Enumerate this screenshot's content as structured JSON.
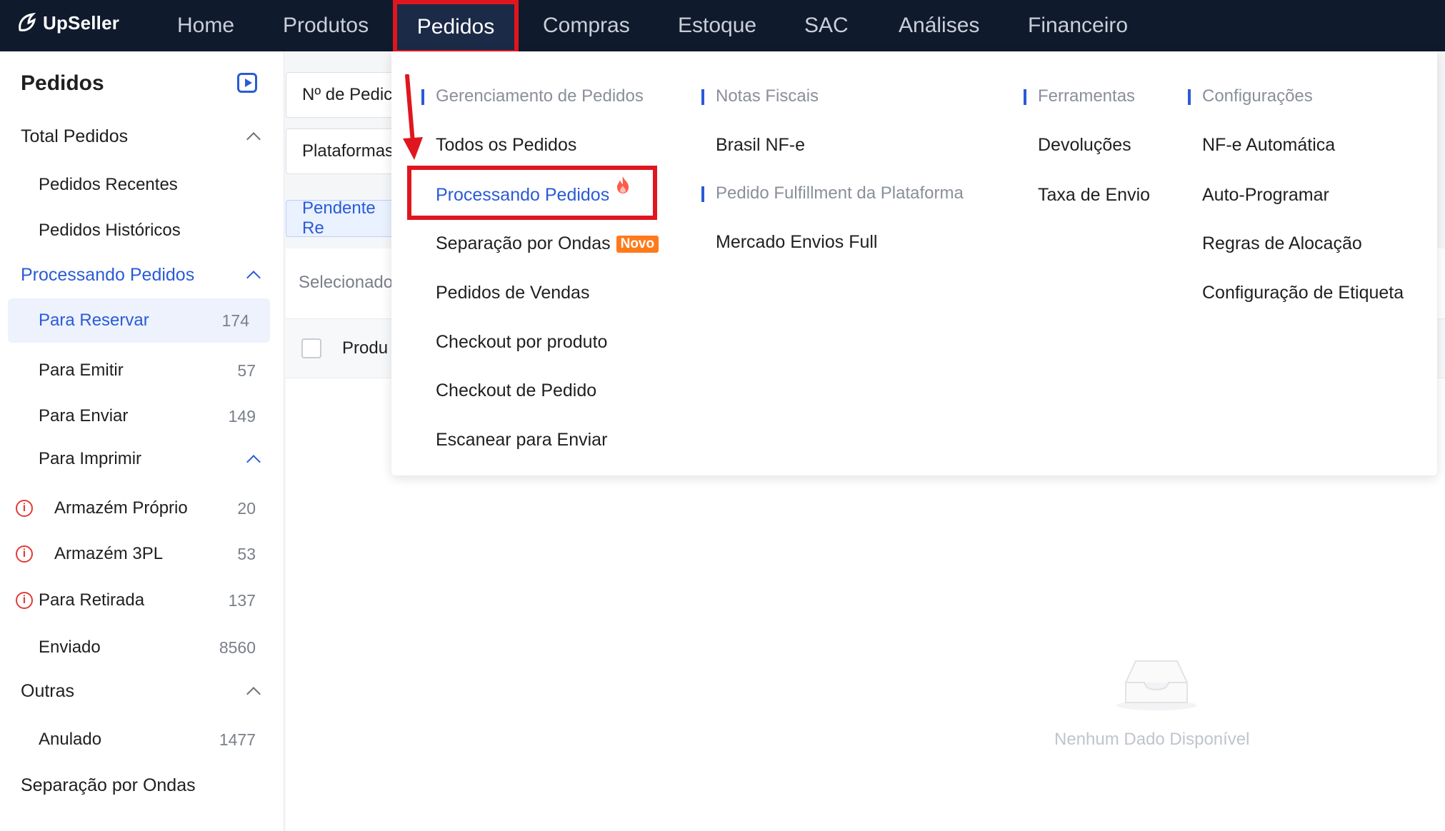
{
  "brand": {
    "name": "UpSeller"
  },
  "nav": [
    {
      "label": "Home"
    },
    {
      "label": "Produtos"
    },
    {
      "label": "Pedidos",
      "active": true
    },
    {
      "label": "Compras"
    },
    {
      "label": "Estoque"
    },
    {
      "label": "SAC"
    },
    {
      "label": "Análises"
    },
    {
      "label": "Financeiro"
    }
  ],
  "sidebar": {
    "title": "Pedidos",
    "total": {
      "label": "Total Pedidos"
    },
    "recentes": {
      "label": "Pedidos Recentes"
    },
    "historicos": {
      "label": "Pedidos Históricos"
    },
    "processando": {
      "label": "Processando Pedidos"
    },
    "para_reservar": {
      "label": "Para Reservar",
      "count": "174"
    },
    "para_emitir": {
      "label": "Para Emitir",
      "count": "57"
    },
    "para_enviar": {
      "label": "Para Enviar",
      "count": "149"
    },
    "para_imprimir": {
      "label": "Para Imprimir"
    },
    "armazem_proprio": {
      "label": "Armazém Próprio",
      "count": "20"
    },
    "armazem_3pl": {
      "label": "Armazém 3PL",
      "count": "53"
    },
    "para_retirada": {
      "label": "Para Retirada",
      "count": "137"
    },
    "enviado": {
      "label": "Enviado",
      "count": "8560"
    },
    "outras": {
      "label": "Outras"
    },
    "anulado": {
      "label": "Anulado",
      "count": "1477"
    },
    "separacao": {
      "label": "Separação por Ondas"
    }
  },
  "main": {
    "filter_order_no": "Nº de Pedic",
    "filter_platforms": "Plataformas",
    "tab_pending": "Pendente Re",
    "selected_text": "Selecionado",
    "col_product": "Produ",
    "empty_text": "Nenhum Dado Disponível"
  },
  "dropdown": {
    "col1": {
      "heading": "Gerenciamento de Pedidos",
      "items": [
        "Todos os Pedidos",
        "Processando Pedidos",
        "Separação por Ondas",
        "Pedidos de Vendas",
        "Checkout por produto",
        "Checkout de Pedido",
        "Escanear para Enviar"
      ],
      "badge": "Novo"
    },
    "col2": {
      "heading1": "Notas Fiscais",
      "item1": "Brasil NF-e",
      "heading2": "Pedido Fulfillment da Plataforma",
      "item2": "Mercado Envios Full"
    },
    "col3": {
      "heading": "Ferramentas",
      "items": [
        "Devoluções",
        "Taxa de Envio"
      ]
    },
    "col4": {
      "heading": "Configurações",
      "items": [
        "NF-e Automática",
        "Auto-Programar",
        "Regras de Alocação",
        "Configuração de Etiqueta"
      ]
    }
  },
  "colors": {
    "accent": "#2a5bd7",
    "nav_bg": "#0f1a2d",
    "highlight": "#e0161f",
    "badge": "#ff7a1a"
  }
}
